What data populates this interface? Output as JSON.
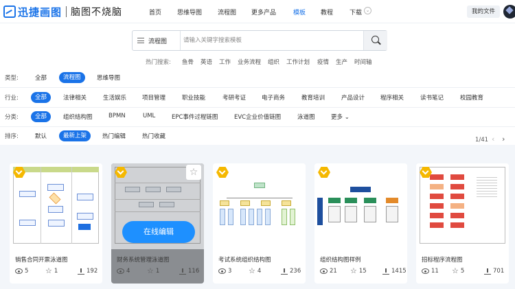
{
  "brand": {
    "name": "迅捷画图",
    "slogan": "脑图不烧脑"
  },
  "nav": [
    "首页",
    "思维导图",
    "流程图",
    "更多产品",
    "模板",
    "教程",
    "下载"
  ],
  "nav_active": "模板",
  "header": {
    "my_files": "我的文件"
  },
  "search": {
    "type": "流程图",
    "placeholder": "请输入关键字搜索模板"
  },
  "hot": {
    "label": "热门搜索:",
    "terms": [
      "鱼骨",
      "英语",
      "工作",
      "业务流程",
      "组织",
      "工作计划",
      "疫情",
      "生产",
      "时间轴"
    ]
  },
  "filters": {
    "type": {
      "label": "类型:",
      "options": [
        "全部",
        "流程图",
        "思维导图"
      ],
      "selected": "流程图"
    },
    "industry": {
      "label": "行业:",
      "options": [
        "全部",
        "法律相关",
        "生活娱乐",
        "项目管理",
        "职业技能",
        "考研考证",
        "电子商务",
        "教育培训",
        "产品设计",
        "程序相关",
        "读书笔记",
        "校园教育"
      ],
      "selected": "全部"
    },
    "category": {
      "label": "分类:",
      "options": [
        "全部",
        "组织结构图",
        "BPMN",
        "UML",
        "EPC事件过程链图",
        "EVC企业价值链图",
        "泳道图",
        "更多"
      ],
      "selected": "全部"
    },
    "sort": {
      "label": "排序:",
      "options": [
        "默认",
        "最新上架",
        "热门编辑",
        "热门收藏"
      ],
      "selected": "最新上架"
    }
  },
  "pagination": {
    "text": "1/41",
    "prev": "‹",
    "next": "›"
  },
  "cards": [
    {
      "title": "销售合同开票泳道图",
      "views": "5",
      "stars": "1",
      "downloads": "192"
    },
    {
      "title": "财务系统管理泳道图",
      "views": "4",
      "stars": "1",
      "downloads": "116",
      "hover_button": "在线编辑"
    },
    {
      "title": "考试系统组织结构图",
      "views": "3",
      "stars": "4",
      "downloads": "236"
    },
    {
      "title": "组织结构图样例",
      "views": "21",
      "stars": "15",
      "downloads": "1415"
    },
    {
      "title": "招标程序流程图",
      "views": "11",
      "stars": "5",
      "downloads": "701"
    }
  ],
  "colors": {
    "accent": "#1a73e8",
    "badge": "#f5b800",
    "edit_button": "#1e90ff"
  },
  "icons": {
    "search": "search-icon",
    "menu": "menu-icon",
    "view": "eye-icon",
    "star": "star-icon",
    "download": "download-icon",
    "badge": "template-badge-icon"
  }
}
